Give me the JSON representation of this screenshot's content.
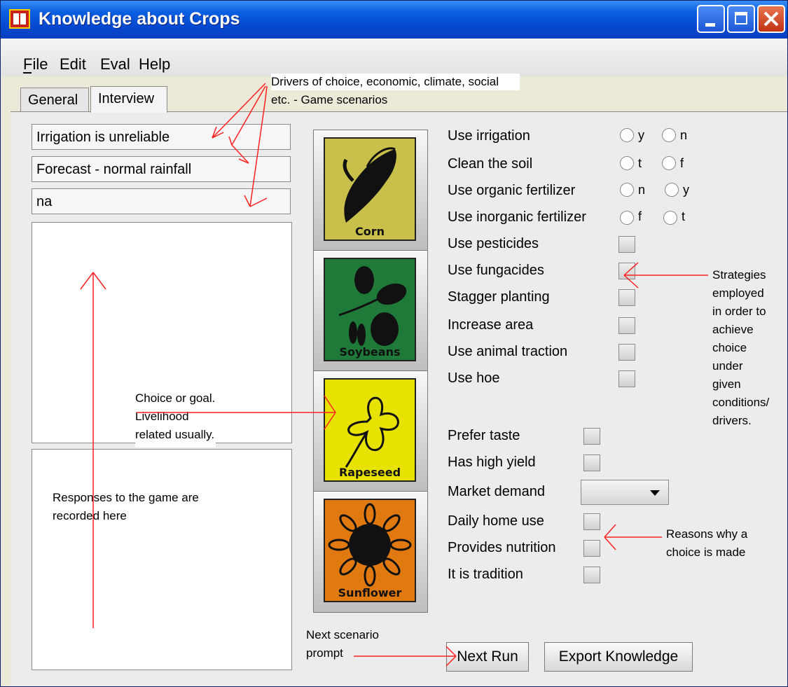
{
  "window": {
    "title": "Knowledge about Crops",
    "controls": [
      "minimize-icon",
      "maximize-icon",
      "close-icon"
    ]
  },
  "menu": [
    "File",
    "Edit",
    "Eval",
    "Help"
  ],
  "tabs": [
    "General",
    "Interview"
  ],
  "active_tab": "Interview",
  "fields": [
    "Irrigation is unreliable",
    "Forecast - normal rainfall",
    "na"
  ],
  "crops": [
    "Corn",
    "Soybeans",
    "Rapeseed",
    "Sunflower"
  ],
  "crop_colors": {
    "Corn": "#c8c04a",
    "Soybeans": "#1f7a3a",
    "Rapeseed": "#e8e200",
    "Sunflower": "#e07a10"
  },
  "radio_strategies": [
    {
      "label": "Use irrigation",
      "opt1": "y",
      "opt2": "n"
    },
    {
      "label": "Clean the soil",
      "opt1": "t",
      "opt2": "f"
    },
    {
      "label": "Use organic fertilizer",
      "opt1": "n",
      "opt2": "y"
    },
    {
      "label": "Use inorganic fertilizer",
      "opt1": "f",
      "opt2": "t"
    }
  ],
  "check_strategies": [
    "Use pesticides",
    "Use fungacides",
    "Stagger planting",
    "Increase area",
    "Use animal traction",
    "Use hoe"
  ],
  "reasons": [
    "Prefer taste",
    "Has high yield",
    "Market demand",
    "Daily home use",
    "Provides nutrition",
    "It is tradition"
  ],
  "buttons": {
    "next": "Next Run",
    "export": "Export Knowledge"
  },
  "annotations": {
    "drivers_1": "Drivers of choice, economic, climate, social",
    "drivers_2": "etc. - Game scenarios",
    "choice_1": "Choice or goal.",
    "choice_2": "Livelihood",
    "choice_3": "related usually.",
    "responses_1": "Responses to the game are",
    "responses_2": "recorded here",
    "strategies": [
      "Strategies",
      "employed",
      "in order to",
      "achieve",
      "choice",
      "under",
      "given",
      "conditions/",
      "drivers."
    ],
    "reasons_1": "Reasons why a",
    "reasons_2": "choice is made",
    "next_1": "Next scenario",
    "next_2": "prompt"
  },
  "accent_color": "#ff2020"
}
